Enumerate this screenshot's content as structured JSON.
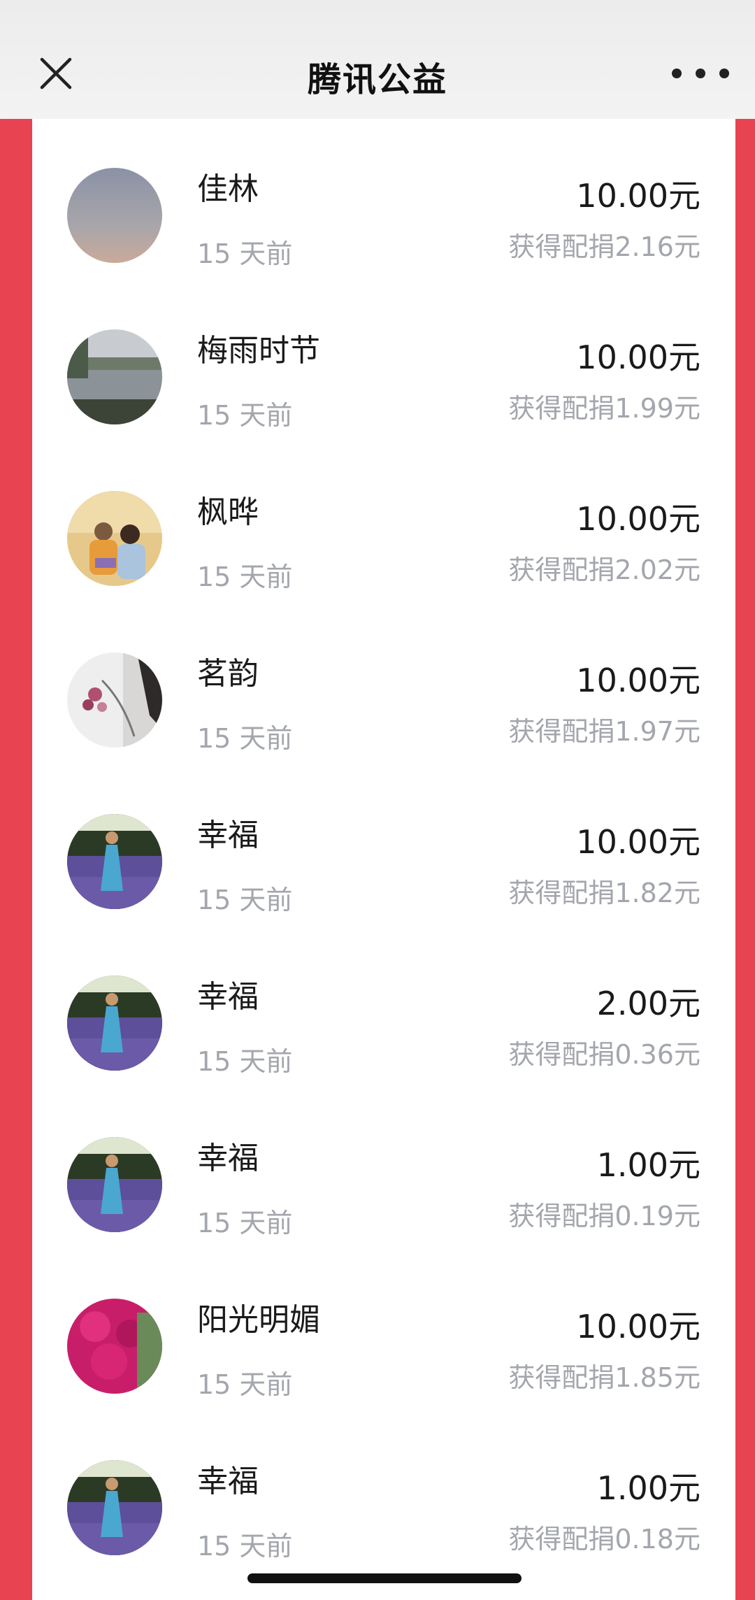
{
  "header": {
    "title": "腾讯公益",
    "close_icon": "close-icon",
    "more_icon": "more-dots-icon"
  },
  "colors": {
    "accent": "#e84351",
    "primary_text": "#1a1a1a",
    "secondary_text": "#a3a6ac",
    "background": "#ffffff"
  },
  "donations": [
    {
      "name": "佳林",
      "time": "15 天前",
      "amount": "10.00元",
      "match": "获得配捐2.16元",
      "avatar": "dusk-sky"
    },
    {
      "name": "梅雨时节",
      "time": "15 天前",
      "amount": "10.00元",
      "match": "获得配捐1.99元",
      "avatar": "lake-landscape"
    },
    {
      "name": "枫晔",
      "time": "15 天前",
      "amount": "10.00元",
      "match": "获得配捐2.02元",
      "avatar": "couple-photo"
    },
    {
      "name": "茗韵",
      "time": "15 天前",
      "amount": "10.00元",
      "match": "获得配捐1.97元",
      "avatar": "flower-bouquet"
    },
    {
      "name": "幸福",
      "time": "15 天前",
      "amount": "10.00元",
      "match": "获得配捐1.82元",
      "avatar": "lavender-field"
    },
    {
      "name": "幸福",
      "time": "15 天前",
      "amount": "2.00元",
      "match": "获得配捐0.36元",
      "avatar": "lavender-field"
    },
    {
      "name": "幸福",
      "time": "15 天前",
      "amount": "1.00元",
      "match": "获得配捐0.19元",
      "avatar": "lavender-field"
    },
    {
      "name": "阳光明媚",
      "time": "15 天前",
      "amount": "10.00元",
      "match": "获得配捐1.85元",
      "avatar": "pink-flowers"
    },
    {
      "name": "幸福",
      "time": "15 天前",
      "amount": "1.00元",
      "match": "获得配捐0.18元",
      "avatar": "lavender-field"
    }
  ]
}
